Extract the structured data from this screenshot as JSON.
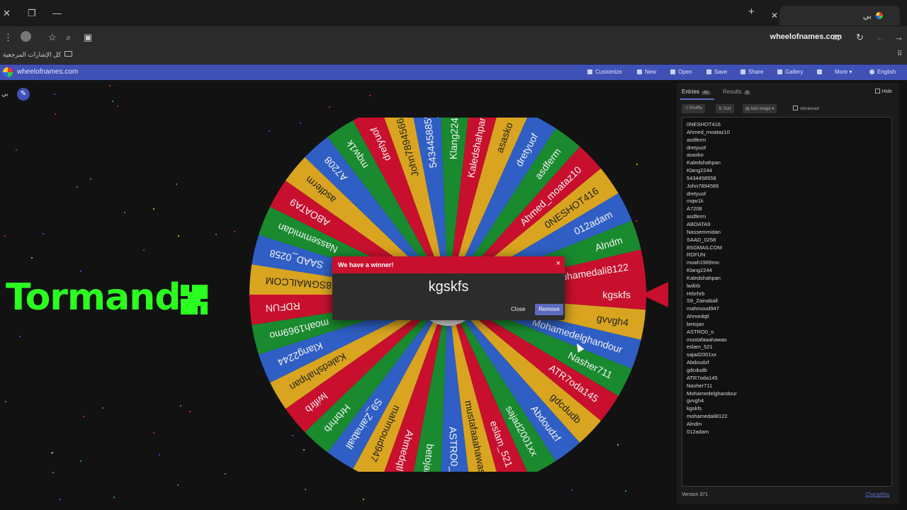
{
  "browser": {
    "window_controls": [
      "✕",
      "❐",
      "—"
    ],
    "new_tab_icon": "+",
    "tab": {
      "title": "بي",
      "close": "✕"
    },
    "url": "wheelofnames.com",
    "bookmarks_label": "كل الإشارات المرجعية"
  },
  "app": {
    "site_name": "wheelofnames.com",
    "menu": [
      {
        "label": "Customize",
        "icon": "palette-icon"
      },
      {
        "label": "New",
        "icon": "file-icon"
      },
      {
        "label": "Open",
        "icon": "folder-icon"
      },
      {
        "label": "Save",
        "icon": "save-icon"
      },
      {
        "label": "Share",
        "icon": "share-icon"
      },
      {
        "label": "Gallery",
        "icon": "search-icon"
      },
      {
        "label": "",
        "icon": "fullscreen-icon"
      },
      {
        "label": "More ▾",
        "icon": ""
      },
      {
        "label": "English",
        "icon": "globe-icon"
      }
    ],
    "left_label": "بي"
  },
  "overlay": {
    "text": "Tormando"
  },
  "wheel": {
    "colors": [
      "#c8102e",
      "#d9a520",
      "#2f5fc4",
      "#1a8a2e"
    ],
    "pointer_color": "#c8102e",
    "segments": [
      "kgskfs",
      "gvvgh4",
      "Mohamedelghandour",
      "Nasher711",
      "ATR7oda145",
      "gdcdudb",
      "Abdoudzf",
      "sajad2001xx",
      "eslam_521",
      "mustafaaahawas",
      "ASTRO0_o",
      "betojan",
      "Ahmedqtl",
      "mahmoud947",
      "S9_Zainaball",
      "Hrbrhrb",
      "lwifirb",
      "Kaledshahpan",
      "Klang2244",
      "moah1969mo",
      "RDFUN",
      "8SGMAILCOM",
      "SAAD_0258",
      "Nassemmidan",
      "ABOATA9",
      "asdferm",
      "A7208",
      "mqw1k",
      "dretyuof",
      "John7894566",
      "5434458855",
      "Klang2244",
      "Kaledshahpan",
      "asasko",
      "dretyuof",
      "asdferm",
      "Ahmed_moataz10",
      "0NESHOT416",
      "012adam",
      "Alndm",
      "mohamedali8122"
    ]
  },
  "dialog": {
    "title": "We have a winner!",
    "close_x": "×",
    "winner": "kgskfs",
    "close_label": "Close",
    "remove_label": "Remove"
  },
  "panel": {
    "entries_tab": "Entries",
    "entries_count": "41",
    "results_tab": "Results",
    "results_count": "0",
    "hide_label": "Hide",
    "shuffle_label": "Shuffle",
    "sort_label": "Sort",
    "add_image_label": "Add image ▾",
    "advanced_label": "Advanced",
    "entries": [
      "0NESHOT416",
      "Ahmed_moataz10",
      "asdferm",
      "dretyuof",
      "asasko",
      "Kaledshahpan",
      "Klang2244",
      "5434458558",
      "John7894566",
      "dretyuof",
      "mqw1k",
      "A7208",
      "asdferm",
      "ABOATA9",
      "Nassemmidan",
      "SAAD_0258",
      "8SGMAILCOM",
      "RDFUN",
      "moah1969mo",
      "Klang2244",
      "Kaledshahpan",
      "lwifirb",
      "Hrbrhrb",
      "S9_Zainaball",
      "mahmoud947",
      "Ahmedqtl",
      "betojan",
      "ASTRO0_o",
      "mustafaaahawas",
      "eslam_521",
      "sajad2001xx",
      "Abdoudzf",
      "gdcdudb",
      "ATR7oda145",
      "Nasher711",
      "Mohamedelghandour",
      "gvvgh4",
      "kgskfs",
      "mohamedali8122",
      "Alndm",
      "012adam"
    ],
    "version": "Version 371",
    "changelog": "Changelog"
  }
}
